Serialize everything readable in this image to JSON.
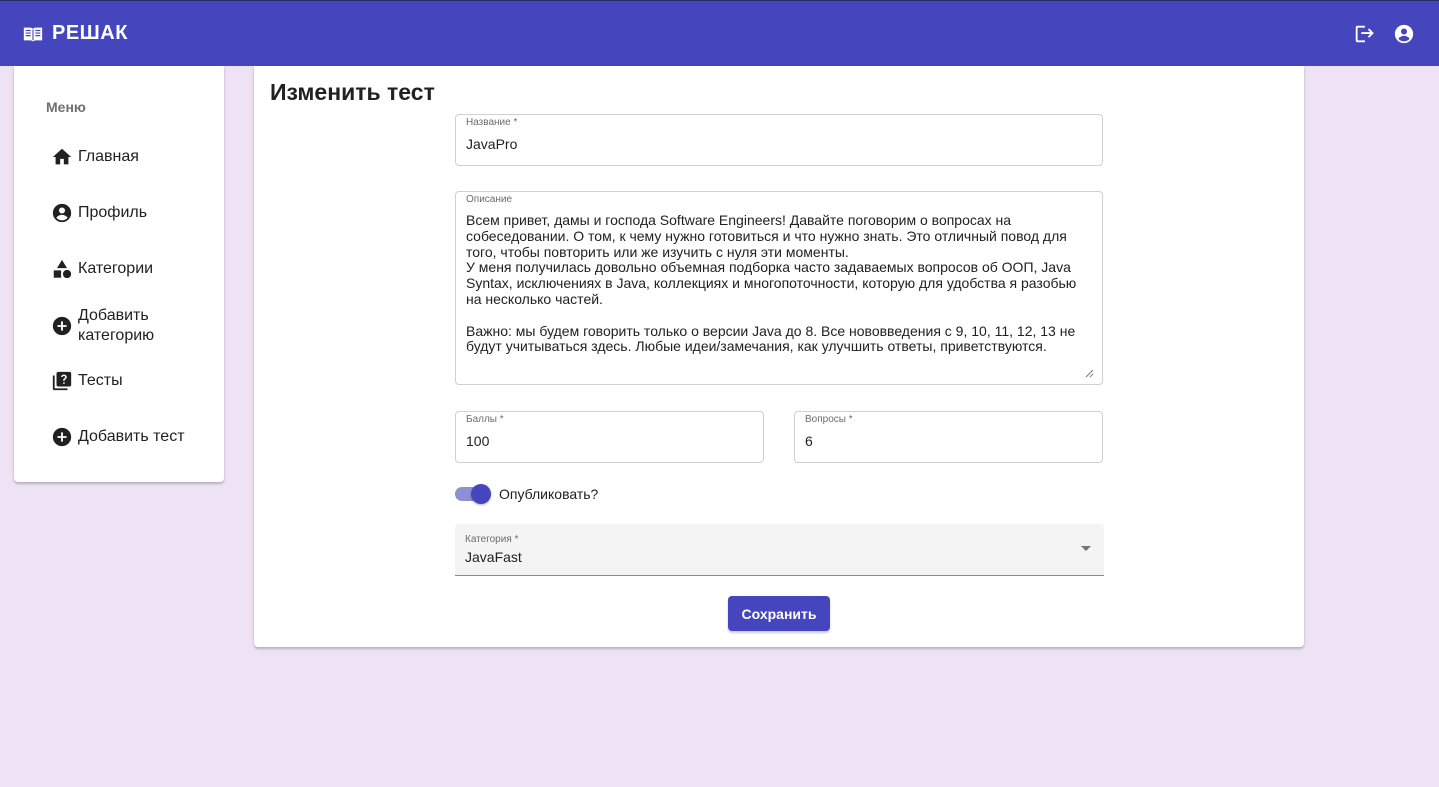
{
  "app": {
    "title": "РЕШАК"
  },
  "topbar": {
    "logout_icon": "logout-icon",
    "account_icon": "account-circle-icon"
  },
  "sidebar": {
    "header": "Меню",
    "items": [
      {
        "label": "Главная",
        "icon": "home-icon"
      },
      {
        "label": "Профиль",
        "icon": "account-circle-icon"
      },
      {
        "label": "Категории",
        "icon": "category-icon"
      },
      {
        "label": "Добавить\nкатегорию",
        "icon": "add-circle-icon"
      },
      {
        "label": "Тесты",
        "icon": "quiz-icon"
      },
      {
        "label": "Добавить тест",
        "icon": "add-circle-icon"
      }
    ]
  },
  "form": {
    "title": "Изменить тест",
    "name_label": "Название *",
    "name_value": "JavaPro",
    "description_label": "Описание",
    "description_value": "Всем привет, дамы и господа Software Engineers! Давайте поговорим о вопросах на\nсобеседовании. О том, к чему нужно готовиться и что нужно знать. Это отличный повод для\nтого, чтобы повторить или же изучить с нуля эти моменты.\nУ меня получилась довольно объемная подборка часто задаваемых вопросов об ООП, Java\nSyntax, исключениях в Java, коллекциях и многопоточности, которую для удобства я разобью\nна несколько частей.\n\nВажно: мы будем говорить только о версии Java до 8. Все нововведения с 9, 10, 11, 12, 13 не\nбудут учитываться здесь. Любые идеи/замечания, как улучшить ответы, приветствуются.",
    "points_label": "Баллы *",
    "points_value": "100",
    "questions_label": "Вопросы *",
    "questions_value": "6",
    "publish_label": "Опубликовать?",
    "publish_checked": true,
    "category_label": "Категория *",
    "category_value": "JavaFast",
    "save_label": "Сохранить"
  },
  "colors": {
    "primary": "#4546bd",
    "background": "#ede3f5",
    "toggle_track": "#8f8fd6"
  }
}
